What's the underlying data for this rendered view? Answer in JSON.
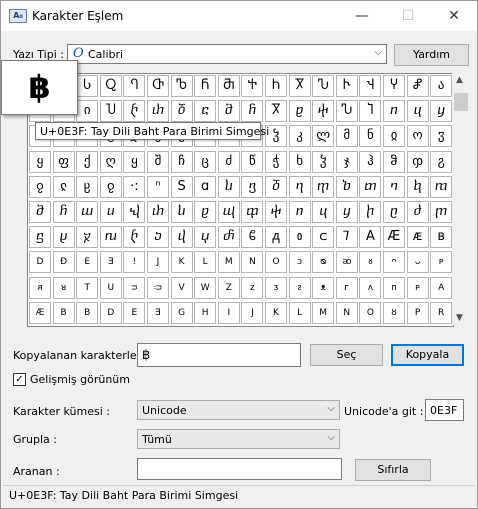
{
  "window": {
    "title": "Karakter Eşlem",
    "app_icon_text": "A₀",
    "minimize_glyph": "—",
    "maximize_glyph": "☐",
    "close_glyph": "✕"
  },
  "font_row": {
    "label": "Yazı Tipi :",
    "font_icon": "O",
    "selected": "Calibri",
    "help_button": "Yardım"
  },
  "grid": {
    "rows": [
      [
        "",
        "Ⴗ",
        "Ⴑ",
        "Ⴍ",
        "Ⴄ",
        "Ⴇ",
        "Ⴊ",
        "Ⴌ",
        "Ⴋ",
        "Ⴕ",
        "Ⴙ",
        "Ⴟ",
        "Ⴠ",
        "Ⴡ",
        "Ⴣ",
        "Ⴤ",
        "Ⴥ",
        "ა"
      ],
      [
        "",
        "ნ",
        "ი",
        "Ⴎ",
        "ⴡ",
        "ⴐ",
        "ⴃ",
        "ⴀ",
        "ⴋ",
        "ⴌ",
        "Ⴟ",
        "ⴒ",
        "ⴕ",
        "Ⴠ",
        "Ⴈ",
        "ⴖ",
        "ⴗ",
        "ⴘ"
      ],
      [
        "",
        "ა",
        "ბ",
        "გ",
        "დ",
        "ე",
        "ვ",
        "ზ",
        "თ",
        "ი",
        "ჴ",
        "კ",
        "ლ",
        "მ",
        "ნ",
        "ჲ",
        "ო",
        "ჳ"
      ],
      [
        "ყ",
        "ფ",
        "ქ",
        "ღ",
        "ყ",
        "შ",
        "ჩ",
        "ც",
        "ძ",
        "წ",
        "ჭ",
        "ხ",
        "ჴ",
        "ჯ",
        "ჰ",
        "ჵ",
        "ჶ",
        "ჷ"
      ],
      [
        "ჹ",
        "ჺ",
        "ჸ",
        "ჹ",
        "·:",
        "ⁿ",
        "S",
        "ɑ",
        "ⴑ",
        "ⴂ",
        "ⴃ",
        "ⴄ",
        "ⴅ",
        "ⴆ",
        "ⴇ",
        "ⴈ",
        "ⴉ",
        "ⴊ"
      ],
      [
        "ⴋ",
        "ⴌ",
        "ⴍ",
        "ⴎ",
        "ⴏ",
        "ⴐ",
        "ⴑ",
        "ⴒ",
        "ⴓ",
        "ⴔ",
        "ⴕ",
        "ⴖ",
        "ⴗ",
        "ⴘ",
        "ⴙ",
        "ⴚ",
        "ⴛ",
        "ⴜ"
      ],
      [
        "ⴝ",
        "ⴞ",
        "ⴟ",
        "ⴠ",
        "ⴡ",
        "ⴢ",
        "ⴣ",
        "ⴤ",
        "ⴥ",
        "ᲀ",
        "ᲁ",
        "ᲂ",
        "ᲃ",
        "ᲄ",
        "A",
        "Æ",
        "ᴁ",
        "ʙ"
      ],
      [
        "D",
        "Đ",
        "E",
        "Ǝ",
        "ǃ",
        "J",
        "K",
        "L",
        "M",
        "N",
        "O",
        "ɔ",
        "ᴓ",
        "ᴔ",
        "ᴕ",
        "ᴖ",
        "ᴗ",
        "ᴘ"
      ],
      [
        "ᴙ",
        "ᴚ",
        "T",
        "U",
        "ᴝ",
        "ᴞ",
        "V",
        "W",
        "Z",
        "ᴢ",
        "ᴣ",
        "ᴤ",
        "ᴥ",
        "ᴦ",
        "ᴧ",
        "ᴨ",
        "ᴩ",
        "A"
      ],
      [
        "Æ",
        "B",
        "B",
        "D",
        "E",
        "Ǝ",
        "G",
        "H",
        "I",
        "J",
        "K",
        "L",
        "M",
        "N",
        "O",
        "ȣ",
        "P",
        "R"
      ]
    ]
  },
  "preview": {
    "glyph": "฿",
    "tooltip": "U+0E3F: Tay Dili Baht Para Birimi Simgesi"
  },
  "scrollbar": {
    "up_glyph": "▲",
    "down_glyph": "▼"
  },
  "copy_row": {
    "label": "Kopyalanan karakterler :",
    "value": "฿",
    "select_button": "Seç",
    "copy_button": "Kopyala"
  },
  "advanced": {
    "checkbox_label": "Gelişmiş görünüm",
    "checked": true,
    "check_glyph": "✓"
  },
  "charset": {
    "label": "Karakter kümesi :",
    "selected": "Unicode",
    "goto_label": "Unicode'a git :",
    "goto_value": "0E3F"
  },
  "group": {
    "label": "Grupla :",
    "selected": "Tümü"
  },
  "search": {
    "label": "Aranan :",
    "value": "",
    "reset_button": "Sıfırla"
  },
  "status": {
    "text": "U+0E3F: Tay Dili Baht Para Birimi Simgesi"
  },
  "dropdown_arrow": "⌵"
}
